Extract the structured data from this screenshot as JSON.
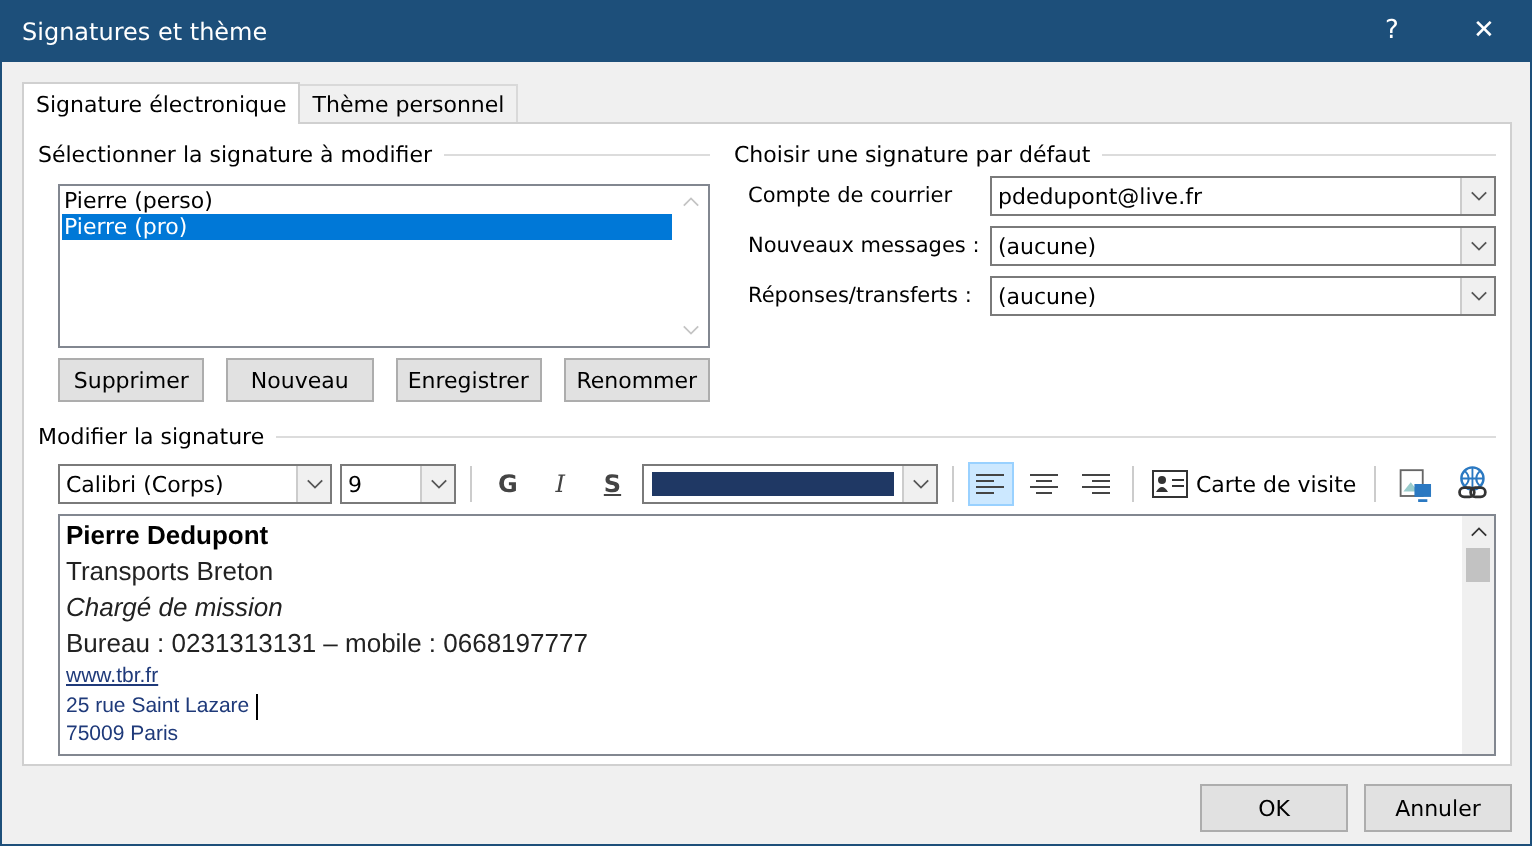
{
  "window": {
    "title": "Signatures et thème",
    "help": "?",
    "close": "✕"
  },
  "tabs": [
    {
      "label": "Signature électronique",
      "selected": true
    },
    {
      "label": "Thème personnel",
      "selected": false
    }
  ],
  "select_group": {
    "title": "Sélectionner la signature à modifier",
    "signatures": [
      {
        "label": "Pierre (perso)",
        "selected": false
      },
      {
        "label": "Pierre (pro)",
        "selected": true
      }
    ],
    "buttons": [
      "Supprimer",
      "Nouveau",
      "Enregistrer",
      "Renommer"
    ]
  },
  "default_group": {
    "title": "Choisir une signature par défaut",
    "fields": [
      {
        "label": "Compte de courrier",
        "value": "pdedupont@live.fr"
      },
      {
        "label": "Nouveaux messages :",
        "value": "(aucune)"
      },
      {
        "label": "Réponses/transferts :",
        "value": "(aucune)"
      }
    ]
  },
  "edit_group": {
    "title": "Modifier la signature",
    "toolbar": {
      "font": "Calibri (Corps)",
      "size": "9",
      "bold": "G",
      "italic": "I",
      "underline": "S",
      "align": [
        {
          "kind": "left",
          "selected": true
        },
        {
          "kind": "center",
          "selected": false
        },
        {
          "kind": "right",
          "selected": false
        }
      ],
      "business_card": "Carte de visite"
    },
    "lines": [
      {
        "kind": "bold",
        "text": "Pierre Dedupont",
        "cursor": false
      },
      {
        "kind": "regular",
        "text": "Transports Breton",
        "cursor": false
      },
      {
        "kind": "italic",
        "text": "Chargé de mission",
        "cursor": false
      },
      {
        "kind": "regular",
        "text": "Bureau : 0231313131 – mobile : 0668197777",
        "cursor": false
      },
      {
        "kind": "link",
        "text": "www.tbr.fr",
        "cursor": false
      },
      {
        "kind": "small",
        "text": "25 rue Saint Lazare",
        "cursor": true
      },
      {
        "kind": "small",
        "text": "75009 Paris",
        "cursor": false
      }
    ]
  },
  "buttons": [
    "OK",
    "Annuler"
  ]
}
